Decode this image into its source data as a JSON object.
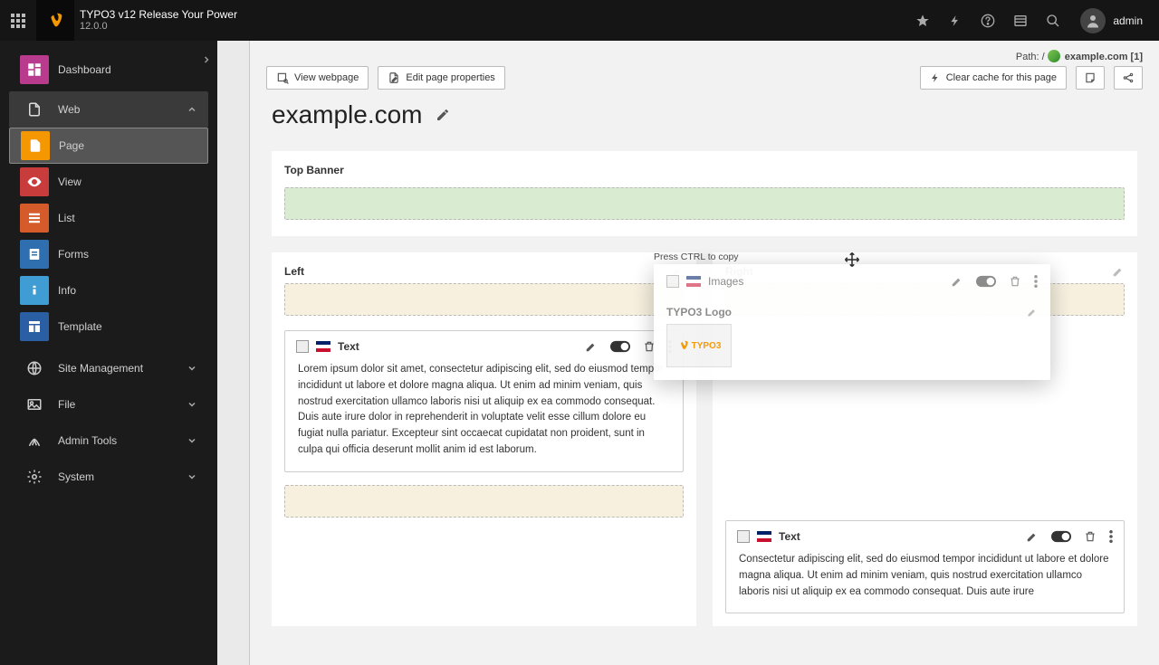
{
  "topbar": {
    "product_title": "TYPO3 v12 Release Your Power",
    "version": "12.0.0",
    "username": "admin"
  },
  "sidebar": {
    "dashboard": "Dashboard",
    "web": "Web",
    "web_items": [
      "Page",
      "View",
      "List",
      "Forms",
      "Info",
      "Template"
    ],
    "groups": [
      "Site Management",
      "File",
      "Admin Tools",
      "System"
    ]
  },
  "path": {
    "prefix": "Path: / ",
    "site": "example.com",
    "suffix": " [1]"
  },
  "actions": {
    "view": "View webpage",
    "edit_props": "Edit page properties",
    "clear_cache": "Clear cache for this page"
  },
  "page_title": "example.com",
  "top_banner_label": "Top Banner",
  "left_label": "Left",
  "right_label": "Right",
  "ce_text_label": "Text",
  "ce_images_label": "Images",
  "drag_hint": "Press CTRL to copy",
  "ghost_title": "TYPO3 Logo",
  "ghost_brand": "TYPO3",
  "left_text": "Lorem ipsum dolor sit amet, consectetur adipiscing elit, sed do eiusmod tempor incididunt ut labore et dolore magna aliqua. Ut enim ad minim veniam, quis nostrud exercitation ullamco laboris nisi ut aliquip ex ea commodo consequat. Duis aute irure dolor in reprehenderit in voluptate velit esse cillum dolore eu fugiat nulla pariatur. Excepteur sint occaecat cupidatat non proident, sunt in culpa qui officia deserunt mollit anim id est laborum.",
  "right_text": "Consectetur adipiscing elit, sed do eiusmod tempor incididunt ut labore et dolore magna aliqua. Ut enim ad minim veniam, quis nostrud exercitation ullamco laboris nisi ut aliquip ex ea commodo consequat. Duis aute irure"
}
